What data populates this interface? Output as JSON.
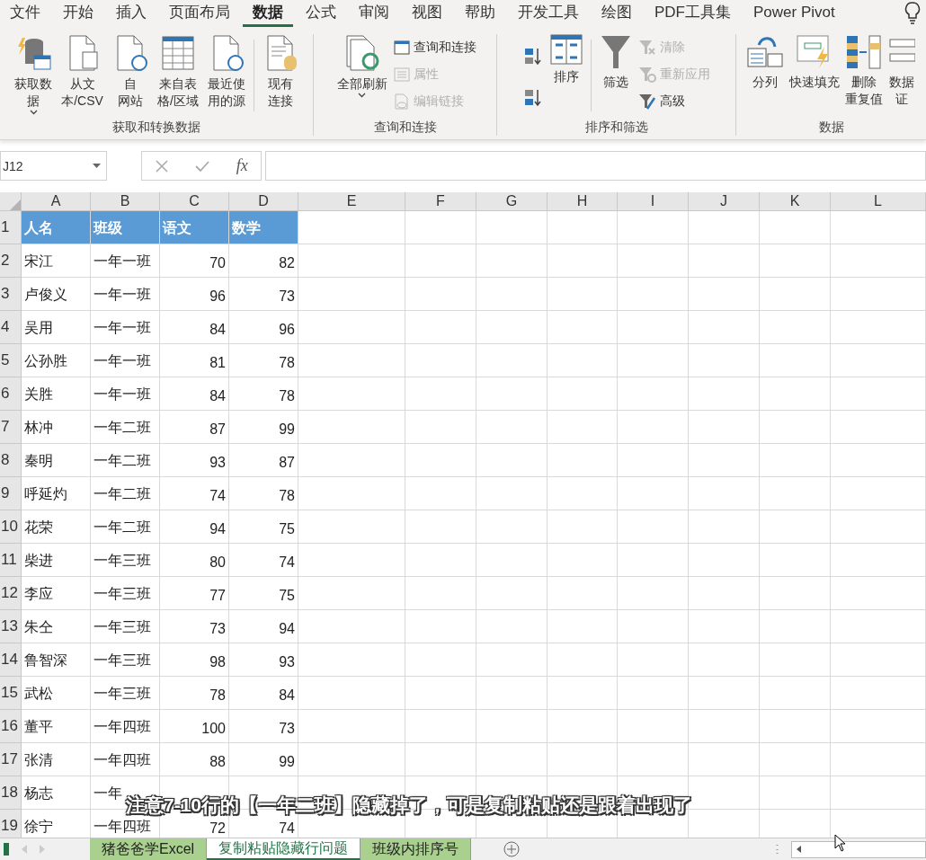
{
  "menu_tabs": [
    {
      "label": "文件",
      "selected": false
    },
    {
      "label": "开始",
      "selected": false
    },
    {
      "label": "插入",
      "selected": false
    },
    {
      "label": "页面布局",
      "selected": false
    },
    {
      "label": "数据",
      "selected": true
    },
    {
      "label": "公式",
      "selected": false
    },
    {
      "label": "审阅",
      "selected": false
    },
    {
      "label": "视图",
      "selected": false
    },
    {
      "label": "帮助",
      "selected": false
    },
    {
      "label": "开发工具",
      "selected": false
    },
    {
      "label": "绘图",
      "selected": false
    },
    {
      "label": "PDF工具集",
      "selected": false
    },
    {
      "label": "Power Pivot",
      "selected": false
    }
  ],
  "ribbon_groups": [
    {
      "label": "获取和转换数据",
      "items": [
        {
          "kind": "large",
          "lines": [
            "获取数",
            "据"
          ],
          "dropdown": true
        },
        {
          "kind": "large",
          "lines": [
            "从文",
            "本/CSV"
          ],
          "dropdown": false
        },
        {
          "kind": "large",
          "lines": [
            "自",
            "网站"
          ],
          "dropdown": false
        },
        {
          "kind": "large",
          "lines": [
            "来自表",
            "格/区域"
          ],
          "dropdown": false
        },
        {
          "kind": "large",
          "lines": [
            "最近使",
            "用的源"
          ],
          "dropdown": false
        },
        {
          "kind": "separator"
        },
        {
          "kind": "large",
          "lines": [
            "现有",
            "连接"
          ],
          "dropdown": false
        }
      ]
    },
    {
      "label": "查询和连接",
      "items": [
        {
          "kind": "large",
          "lines": [
            "全部刷新"
          ],
          "dropdown": true
        },
        {
          "kind": "small",
          "items": [
            {
              "label": "查询和连接",
              "disabled": false
            },
            {
              "label": "属性",
              "disabled": true
            },
            {
              "label": "编辑链接",
              "disabled": true
            }
          ]
        }
      ]
    },
    {
      "label": "排序和筛选",
      "items": [
        {
          "kind": "sort-icons"
        },
        {
          "kind": "large",
          "lines": [
            "排序"
          ],
          "dropdown": false
        },
        {
          "kind": "separator"
        },
        {
          "kind": "large",
          "lines": [
            "筛选"
          ],
          "dropdown": false
        },
        {
          "kind": "small",
          "items": [
            {
              "label": "清除",
              "disabled": true
            },
            {
              "label": "重新应用",
              "disabled": true
            },
            {
              "label": "高级",
              "disabled": false
            }
          ]
        }
      ]
    },
    {
      "label": "数据",
      "items": [
        {
          "kind": "large",
          "lines": [
            "分列"
          ],
          "dropdown": false
        },
        {
          "kind": "large",
          "lines": [
            "快速填充"
          ],
          "dropdown": false
        },
        {
          "kind": "large",
          "lines": [
            "删除",
            "重复值"
          ],
          "dropdown": false
        },
        {
          "kind": "large",
          "lines": [
            "数据",
            "证"
          ],
          "dropdown": false
        }
      ]
    }
  ],
  "formula_bar": {
    "name_box": "J12",
    "fx": "fx"
  },
  "sheet": {
    "columns": [
      "A",
      "B",
      "C",
      "D",
      "E",
      "F",
      "G",
      "H",
      "I",
      "J",
      "K",
      "L"
    ],
    "rows": [
      {
        "number": "1",
        "kind": "header",
        "cells": [
          "人名",
          "班级",
          "语文",
          "数学"
        ]
      },
      {
        "number": "2",
        "kind": "data",
        "cells": [
          "宋江",
          "一年一班",
          "70",
          "82"
        ]
      },
      {
        "number": "3",
        "kind": "data",
        "cells": [
          "卢俊义",
          "一年一班",
          "96",
          "73"
        ]
      },
      {
        "number": "4",
        "kind": "data",
        "cells": [
          "吴用",
          "一年一班",
          "84",
          "96"
        ]
      },
      {
        "number": "5",
        "kind": "data",
        "cells": [
          "公孙胜",
          "一年一班",
          "81",
          "78"
        ]
      },
      {
        "number": "6",
        "kind": "data",
        "cells": [
          "关胜",
          "一年一班",
          "84",
          "78"
        ]
      },
      {
        "number": "7",
        "kind": "data",
        "cells": [
          "林冲",
          "一年二班",
          "87",
          "99"
        ]
      },
      {
        "number": "8",
        "kind": "data",
        "cells": [
          "秦明",
          "一年二班",
          "93",
          "87"
        ]
      },
      {
        "number": "9",
        "kind": "data",
        "cells": [
          "呼延灼",
          "一年二班",
          "74",
          "78"
        ]
      },
      {
        "number": "10",
        "kind": "data",
        "cells": [
          "花荣",
          "一年二班",
          "94",
          "75"
        ]
      },
      {
        "number": "11",
        "kind": "data",
        "cells": [
          "柴进",
          "一年三班",
          "80",
          "74"
        ]
      },
      {
        "number": "12",
        "kind": "data",
        "cells": [
          "李应",
          "一年三班",
          "77",
          "75"
        ]
      },
      {
        "number": "13",
        "kind": "data",
        "cells": [
          "朱仝",
          "一年三班",
          "73",
          "94"
        ]
      },
      {
        "number": "14",
        "kind": "data",
        "cells": [
          "鲁智深",
          "一年三班",
          "98",
          "93"
        ]
      },
      {
        "number": "15",
        "kind": "data",
        "cells": [
          "武松",
          "一年三班",
          "78",
          "84"
        ]
      },
      {
        "number": "16",
        "kind": "data",
        "cells": [
          "董平",
          "一年四班",
          "100",
          "73"
        ]
      },
      {
        "number": "17",
        "kind": "data",
        "cells": [
          "张清",
          "一年四班",
          "88",
          "99"
        ]
      },
      {
        "number": "18",
        "kind": "data",
        "cells": [
          "杨志",
          "一年"
        ]
      },
      {
        "number": "19",
        "kind": "data",
        "cells": [
          "徐宁",
          "一年四班",
          "72",
          "74"
        ]
      }
    ]
  },
  "sheet_tabs": [
    {
      "label": "猪爸爸学Excel",
      "selected": false
    },
    {
      "label": "复制粘贴隐藏行问题",
      "selected": true
    },
    {
      "label": "班级内排序号",
      "selected": false
    }
  ],
  "subtitle": "注意7-10行的【一年二班】隐藏掉了，可是复制粘贴还是跟着出现了"
}
